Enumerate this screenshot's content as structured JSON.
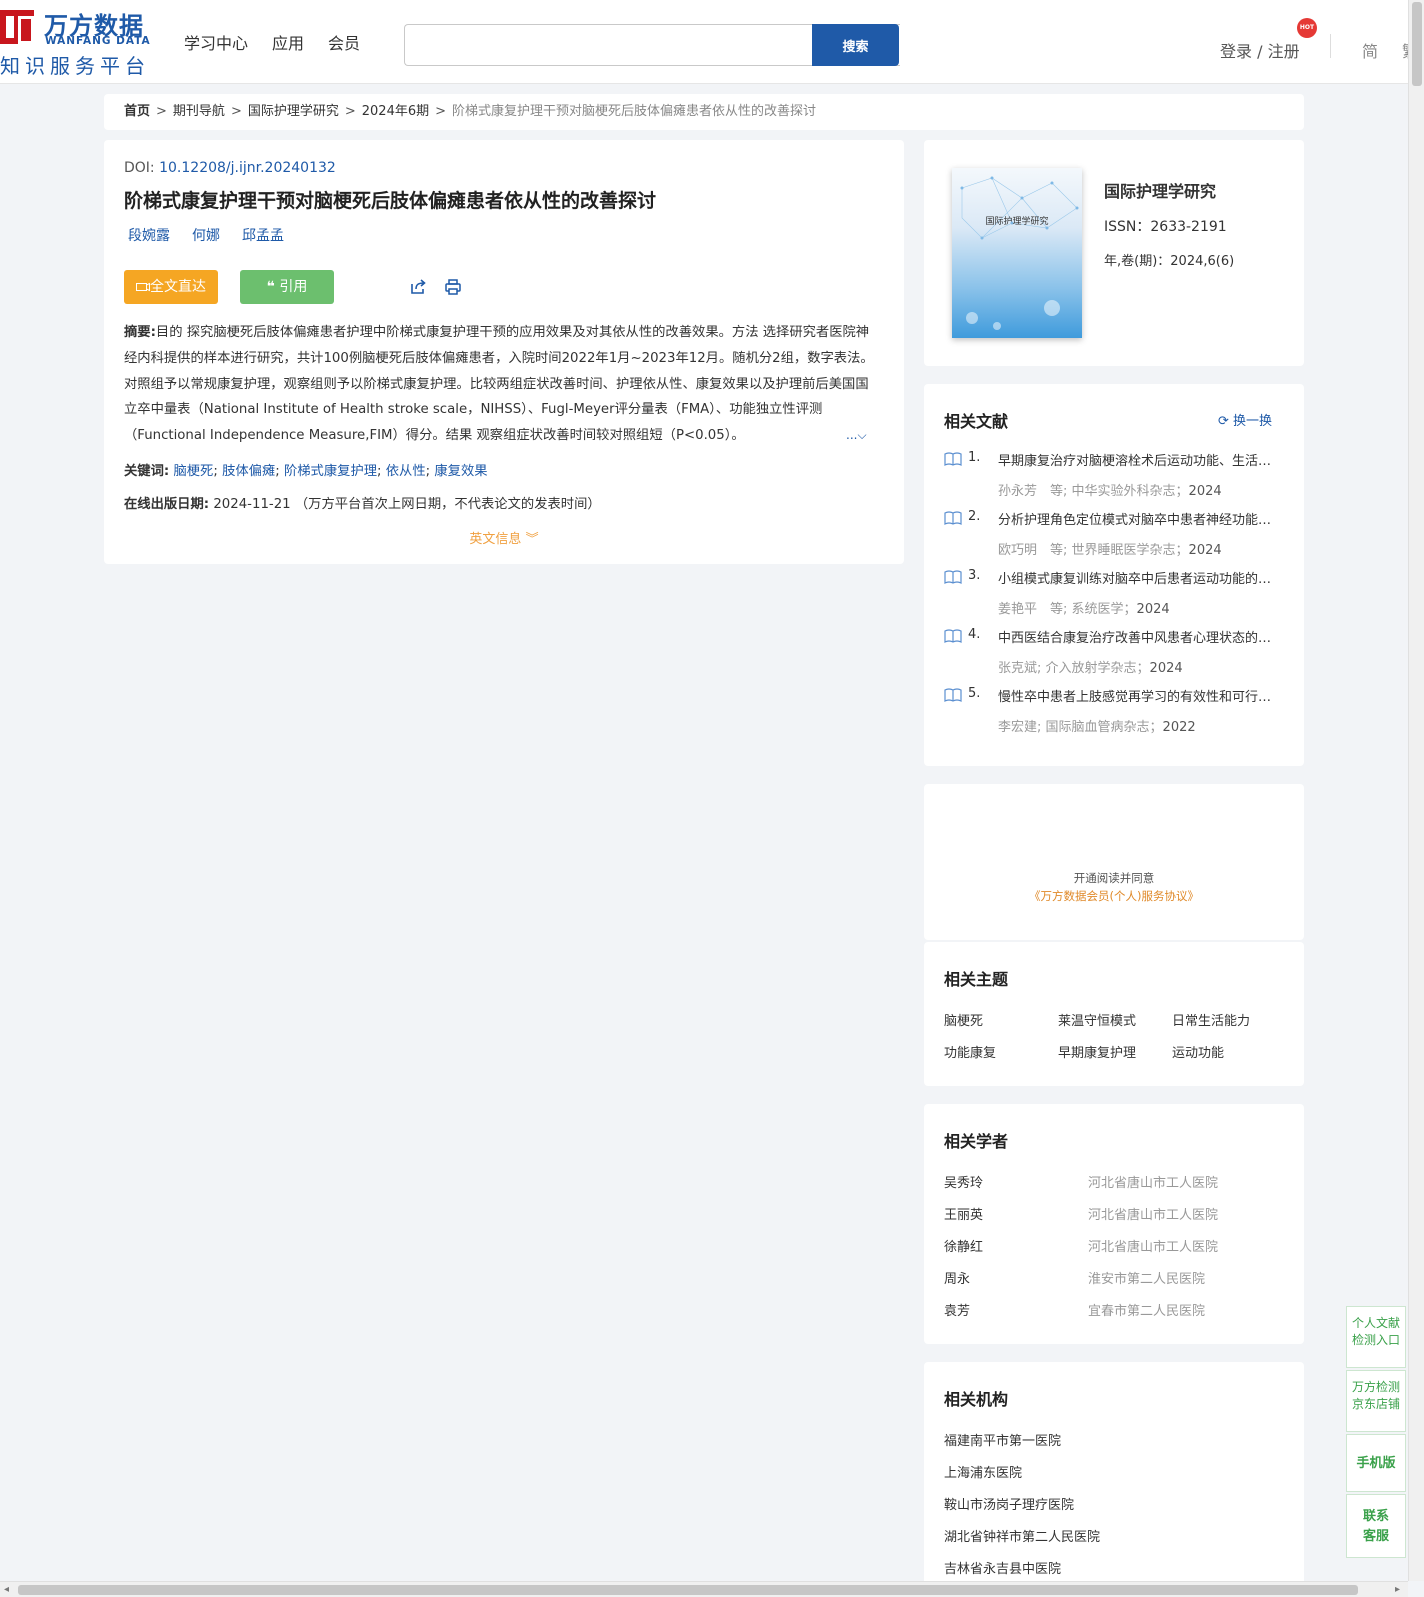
{
  "header": {
    "logo_cn": "万方数据",
    "logo_en": "WANFANG DATA",
    "logo_sub": "知识服务平台",
    "nav": [
      "学习中心",
      "应用",
      "会员"
    ],
    "search_placeholder": "",
    "search_button": "搜索",
    "login": "登录 / 注册",
    "hot_badge": "HOT",
    "lang": "简",
    "lang2": "繁"
  },
  "breadcrumb": [
    "首页",
    "期刊导航",
    "国际护理学研究",
    "2024年6期",
    "阶梯式康复护理干预对脑梗死后肢体偏瘫患者依从性的改善探讨"
  ],
  "article": {
    "doi_label": "DOI:",
    "doi": "10.12208/j.ijnr.20240132",
    "title": "阶梯式康复护理干预对脑梗死后肢体偏瘫患者依从性的改善探讨",
    "authors": [
      "段婉露",
      "何娜",
      "邱孟孟"
    ],
    "btn_fulltext": "全文直达",
    "btn_cite": "引用",
    "abstract_label": "摘要:",
    "abstract": "目的 探究脑梗死后肢体偏瘫患者护理中阶梯式康复护理干预的应用效果及对其依从性的改善效果。方法 选择研究者医院神经内科提供的样本进行研究，共计100例脑梗死后肢体偏瘫患者，入院时间2022年1月~2023年12月。随机分2组，数字表法。对照组予以常规康复护理，观察组则予以阶梯式康复护理。比较两组症状改善时间、护理依从性、康复效果以及护理前后美国国立卒中量表（National Institute of Health stroke scale，NIHSS）、Fugl-Meyer评分量表（FMA）、功能独立性评测（Functional Independence Measure,FIM）得分。结果 观察组症状改善时间较对照组短（P<0.05）。",
    "expand": "...",
    "keywords_label": "关键词:",
    "keywords": [
      "脑梗死",
      "肢体偏瘫",
      "阶梯式康复护理",
      "依从性",
      "康复效果"
    ],
    "pubdate_label": "在线出版日期:",
    "pubdate": "2024-11-21",
    "pubdate_note": "（万方平台首次上网日期，不代表论文的发表时间）",
    "en_info": "英文信息"
  },
  "journal": {
    "cover_title": "国际护理学研究",
    "name": "国际护理学研究",
    "issn": "ISSN：2633-2191",
    "volume": "年,卷(期)：2024,6(6)"
  },
  "related": {
    "title": "相关文献",
    "refresh": "换一换",
    "items": [
      {
        "num": "1.",
        "title": "早期康复治疗对脑梗溶栓术后运动功能、生活质量的影响",
        "authors": "孙永芳　等;",
        "source": "中华实验外科杂志；",
        "year": "2024"
      },
      {
        "num": "2.",
        "title": "分析护理角色定位模式对脑卒中患者神经功能的影响",
        "authors": "欧巧明　等;",
        "source": "世界睡眠医学杂志；",
        "year": "2024"
      },
      {
        "num": "3.",
        "title": "小组模式康复训练对脑卒中后患者运动功能的影响",
        "authors": "姜艳平　等;",
        "source": "系统医学；",
        "year": "2024"
      },
      {
        "num": "4.",
        "title": "中西医结合康复治疗改善中风患者心理状态的研究",
        "authors": "张克斌;",
        "source": "介入放射学杂志；",
        "year": "2024"
      },
      {
        "num": "5.",
        "title": "慢性卒中患者上肢感觉再学习的有效性和可行性研究",
        "authors": "李宏建;",
        "source": "国际脑血管病杂志；",
        "year": "2022"
      }
    ]
  },
  "membership": {
    "line1": "开通阅读并同意",
    "line2": "《万方数据会员(个人)服务协议》"
  },
  "topics": {
    "title": "相关主题",
    "items": [
      "脑梗死",
      "莱温守恒模式",
      "日常生活能力",
      "功能康复",
      "早期康复护理",
      "运动功能"
    ]
  },
  "scholars": {
    "title": "相关学者",
    "items": [
      {
        "name": "吴秀玲",
        "org": "河北省唐山市工人医院"
      },
      {
        "name": "王丽英",
        "org": "河北省唐山市工人医院"
      },
      {
        "name": "徐静红",
        "org": "河北省唐山市工人医院"
      },
      {
        "name": "周永",
        "org": "淮安市第二人民医院"
      },
      {
        "name": "袁芳",
        "org": "宜春市第二人民医院"
      }
    ]
  },
  "institutions": {
    "title": "相关机构",
    "items": [
      "福建南平市第一医院",
      "上海浦东医院",
      "鞍山市汤岗子理疗医院",
      "湖北省钟祥市第二人民医院",
      "吉林省永吉县中医院"
    ]
  },
  "float_bar": [
    "个人文献检测入口",
    "万方检测京东店铺",
    "手机版",
    "联系客服"
  ],
  "colors": {
    "brand_blue": "#1f5aa8",
    "logo_red": "#c8161d",
    "fulltext_orange": "#f5a623",
    "cite_green": "#6cbf6e",
    "float_green": "#3aa14a"
  }
}
